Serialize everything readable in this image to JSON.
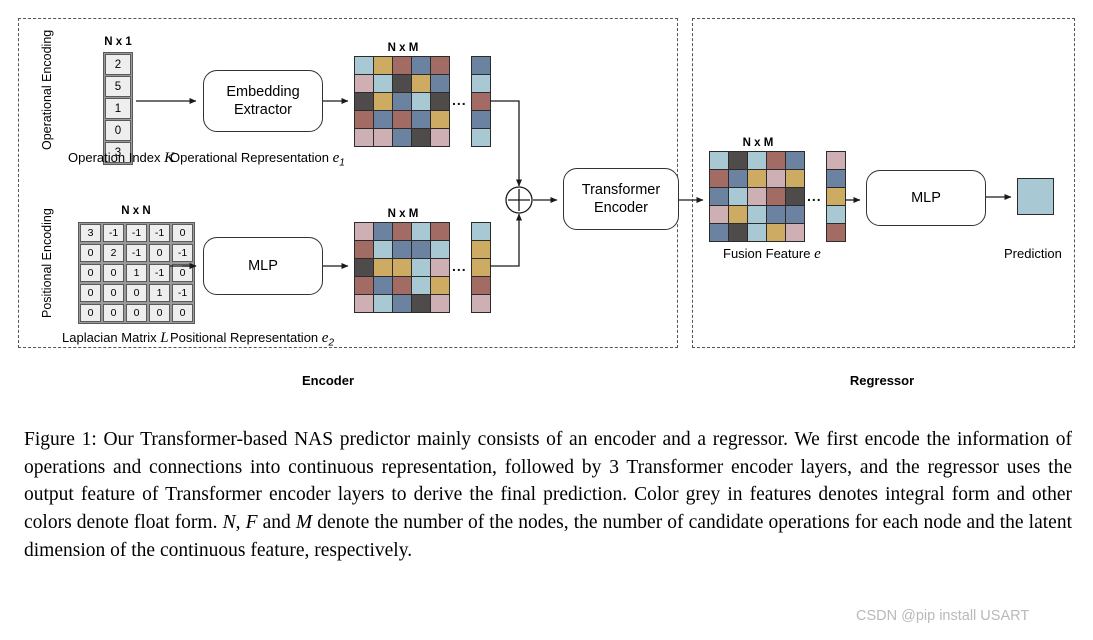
{
  "figure": {
    "panels": {
      "encoder_label": "Encoder",
      "regressor_label": "Regressor"
    },
    "side_labels": {
      "operational": "Operational Encoding",
      "positional": "Positional Encoding"
    },
    "dim_labels": {
      "op_index": "N x 1",
      "laplacian": "N x N",
      "op_rep": "N x M",
      "pos_rep": "N x M",
      "fusion": "N x M"
    },
    "op_index": {
      "values": [
        "2",
        "5",
        "1",
        "0",
        "3"
      ],
      "caption_text": "Operation Index",
      "caption_symbol": "K"
    },
    "laplacian": {
      "rows": [
        [
          "3",
          "-1",
          "-1",
          "-1",
          "0"
        ],
        [
          "0",
          "2",
          "-1",
          "0",
          "-1"
        ],
        [
          "0",
          "0",
          "1",
          "-1",
          "0"
        ],
        [
          "0",
          "0",
          "0",
          "1",
          "-1"
        ],
        [
          "0",
          "0",
          "0",
          "0",
          "0"
        ]
      ],
      "caption_text": "Laplacian Matrix",
      "caption_symbol": "L"
    },
    "boxes": {
      "embedding_extractor": "Embedding Extractor",
      "mlp_encoder": "MLP",
      "transformer_encoder": "Transformer Encoder",
      "mlp_regressor": "MLP"
    },
    "op_representation": {
      "caption_text": "Operational Representation",
      "caption_symbol": "e",
      "caption_sub": "1",
      "ellipsis": "...",
      "grid": [
        [
          "#a8c8d4",
          "#ceab62",
          "#a26b63",
          "#6b83a0",
          "#a26b63"
        ],
        [
          "#ceb0b4",
          "#a8c8d4",
          "#4f4b4a",
          "#ceab62",
          "#6b83a0"
        ],
        [
          "#4f4b4a",
          "#ceab62",
          "#6b83a0",
          "#a8c8d4",
          "#4f4b4a"
        ],
        [
          "#a26b63",
          "#6b83a0",
          "#a26b63",
          "#6b83a0",
          "#ceab62"
        ],
        [
          "#ceb0b4",
          "#ceb0b4",
          "#6b83a0",
          "#4f4b4a",
          "#ceb0b4"
        ]
      ],
      "column": [
        "#6b83a0",
        "#a8c8d4",
        "#a26b63",
        "#6b83a0",
        "#a8c8d4"
      ]
    },
    "pos_representation": {
      "caption_text": "Positional Representation",
      "caption_symbol": "e",
      "caption_sub": "2",
      "ellipsis": "...",
      "grid": [
        [
          "#ceb0b4",
          "#6b83a0",
          "#a26b63",
          "#a8c8d4",
          "#a26b63"
        ],
        [
          "#a26b63",
          "#a8c8d4",
          "#6b83a0",
          "#6b83a0",
          "#a8c8d4"
        ],
        [
          "#4f4b4a",
          "#ceab62",
          "#ceab62",
          "#a8c8d4",
          "#ceb0b4"
        ],
        [
          "#a26b63",
          "#6b83a0",
          "#a26b63",
          "#a8c8d4",
          "#ceab62"
        ],
        [
          "#ceb0b4",
          "#a8c8d4",
          "#6b83a0",
          "#4f4b4a",
          "#ceb0b4"
        ]
      ],
      "column": [
        "#a8c8d4",
        "#ceab62",
        "#ceab62",
        "#a26b63",
        "#ceb0b4"
      ]
    },
    "fusion_feature": {
      "caption_text": "Fusion Feature",
      "caption_symbol": "e",
      "ellipsis": "...",
      "grid": [
        [
          "#a8c8d4",
          "#4f4b4a",
          "#a8c8d4",
          "#a26b63",
          "#6b83a0"
        ],
        [
          "#a26b63",
          "#6b83a0",
          "#ceab62",
          "#ceb0b4",
          "#ceab62"
        ],
        [
          "#6b83a0",
          "#a8c8d4",
          "#ceb0b4",
          "#a26b63",
          "#4f4b4a"
        ],
        [
          "#ceb0b4",
          "#ceab62",
          "#a8c8d4",
          "#6b83a0",
          "#6b83a0"
        ],
        [
          "#6b83a0",
          "#4f4b4a",
          "#a8c8d4",
          "#ceab62",
          "#ceb0b4"
        ]
      ],
      "column": [
        "#ceb0b4",
        "#6b83a0",
        "#ceab62",
        "#a8c8d4",
        "#a26b63"
      ]
    },
    "prediction": {
      "caption": "Prediction",
      "color": "#a8c8d4"
    },
    "fusion_operator": "plus-circle"
  },
  "caption": {
    "full_text": "Figure 1: Our Transformer-based NAS predictor mainly consists of an encoder and a regressor. We first encode the information of operations and connections into continuous representation, followed by 3 Transformer encoder layers, and the regressor uses the output feature of Transformer encoder layers to derive the final prediction. Color grey in features denotes integral form and other colors denote float form. N, F and M denote the number of the nodes, the number of candidate operations for each node and the latent dimension of the continuous feature, respectively."
  },
  "watermark": {
    "text": "CSDN @pip install USART"
  }
}
